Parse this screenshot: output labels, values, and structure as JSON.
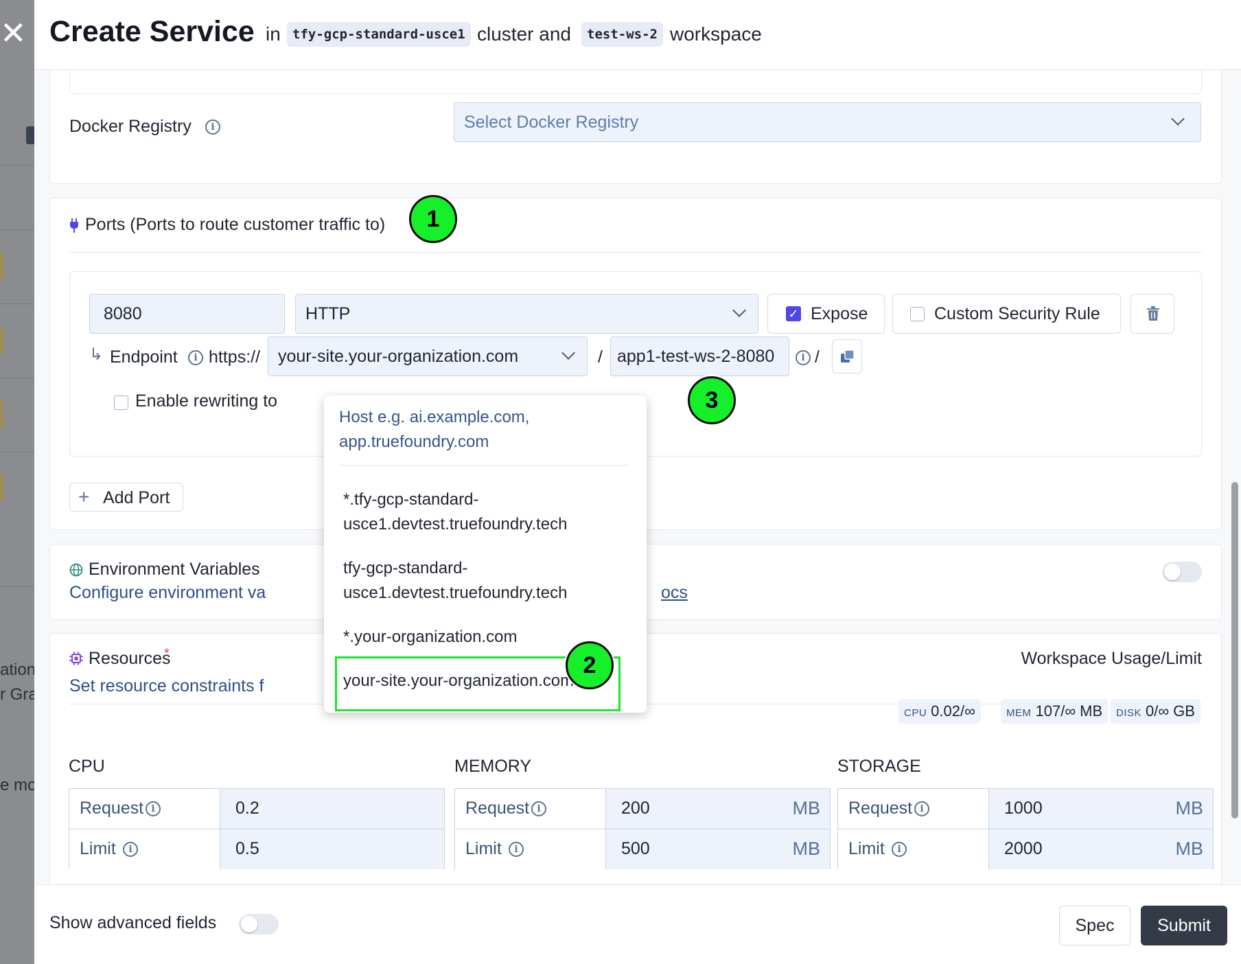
{
  "header": {
    "title": "Create Service",
    "in_text": "in",
    "cluster_chip": "tfy-gcp-standard-usce1",
    "cluster_text": "cluster and",
    "workspace_chip": "test-ws-2",
    "workspace_text": "workspace"
  },
  "background_page": {
    "text_1": "ation",
    "text_2": "r Gra",
    "text_3": "e mo"
  },
  "docker_registry": {
    "label": "Docker Registry",
    "placeholder": "Select Docker Registry"
  },
  "ports": {
    "title": "Ports (Ports to route customer traffic to)",
    "port_value": "8080",
    "protocol": "HTTP",
    "expose_label": "Expose",
    "expose_checked": true,
    "custom_security_label": "Custom Security Rule",
    "custom_security_checked": false,
    "endpoint_label": "Endpoint",
    "endpoint_prefix": "https://",
    "host_selected": "your-site.your-organization.com",
    "slash": "/",
    "path_value": "app1-test-ws-2-8080",
    "rewrite_label": "Enable rewriting to",
    "add_port_label": "Add Port"
  },
  "host_dropdown": {
    "placeholder": "Host e.g. ai.example.com, app.truefoundry.com",
    "options": [
      "*.tfy-gcp-standard-usce1.devtest.truefoundry.tech",
      "tfy-gcp-standard-usce1.devtest.truefoundry.tech",
      "*.your-organization.com",
      "your-site.your-organization.com"
    ]
  },
  "env_vars": {
    "title": "Environment Variables",
    "description": "Configure environment va",
    "docs_fragment": "ocs",
    "enabled": false
  },
  "resources": {
    "title": "Resources",
    "required_mark": "*",
    "description": "Set resource constraints f",
    "usage_title": "Workspace Usage/Limit",
    "usage": [
      {
        "key": "CPU",
        "value": "0.02/∞"
      },
      {
        "key": "MEM",
        "value": "107/∞ MB"
      },
      {
        "key": "DISK",
        "value": "0/∞ GB"
      }
    ],
    "groups": [
      {
        "title": "CPU",
        "request_label": "Request",
        "request": "0.2",
        "limit_label": "Limit",
        "limit": "0.5",
        "unit": ""
      },
      {
        "title": "MEMORY",
        "request_label": "Request",
        "request": "200",
        "limit_label": "Limit",
        "limit": "500",
        "unit": "MB"
      },
      {
        "title": "STORAGE",
        "request_label": "Request",
        "request": "1000",
        "limit_label": "Limit",
        "limit": "2000",
        "unit": "MB"
      }
    ]
  },
  "footer": {
    "advanced_label": "Show advanced fields",
    "advanced_enabled": false,
    "spec_label": "Spec",
    "submit_label": "Submit"
  },
  "markers": [
    "1",
    "2",
    "3"
  ],
  "colors": {
    "accent": "#4f46e5",
    "marker_green": "#15f02a",
    "highlight_green": "#18e82c",
    "submit_bg": "#343a46"
  }
}
